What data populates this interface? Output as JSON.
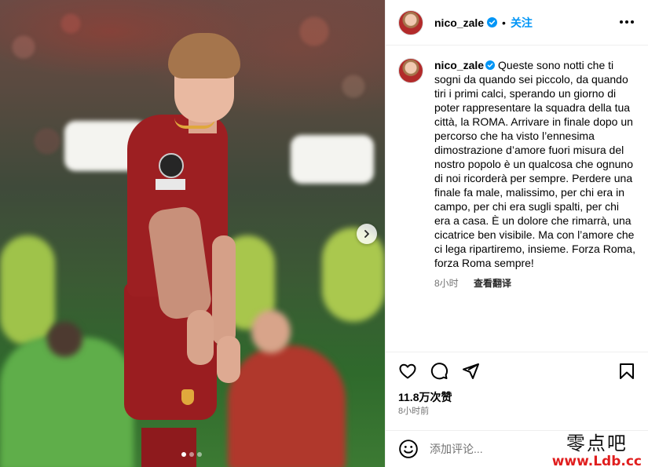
{
  "post": {
    "username": "nico_zale",
    "separator": "•",
    "follow_label": "关注",
    "verified_icon": "verified-badge-icon",
    "more_icon": "more-options-icon"
  },
  "caption": {
    "username": "nico_zale",
    "text": "Queste sono notti che ti sogni da quando sei piccolo, da quando tiri i primi calci, sperando un giorno di poter rappresentare la squadra della tua città, la ROMA. Arrivare in finale dopo un percorso che ha visto l’ennesima dimostrazione d’amore fuori misura del nostro popolo è un qualcosa che ognuno di noi ricorderà per sempre. Perdere una finale fa male, malissimo, per chi era in campo, per chi era sugli spalti, per chi era a casa. È un dolore che rimarrà, una cicatrice ben visibile. Ma con l’amore che ci lega ripartiremo, insieme. Forza Roma, forza Roma sempre!",
    "time_ago": "8小时",
    "see_translation": "查看翻译"
  },
  "actions": {
    "like_icon": "heart-icon",
    "comment_icon": "comment-icon",
    "share_icon": "share-icon",
    "save_icon": "bookmark-icon"
  },
  "stats": {
    "likes": "11.8万次赞",
    "posted_ago": "8小时前"
  },
  "comment": {
    "placeholder": "添加评论...",
    "emoji_icon": "emoji-icon"
  },
  "carousel": {
    "next_icon": "chevron-right-icon",
    "slide_count": 3,
    "active_index": 0
  },
  "watermark": {
    "top": "零点吧",
    "bottom": "www.Ldb.cc"
  },
  "colors": {
    "accent": "#0095f6",
    "muted": "#737373",
    "divider": "#efefef",
    "watermark_red": "#e01e1e"
  }
}
